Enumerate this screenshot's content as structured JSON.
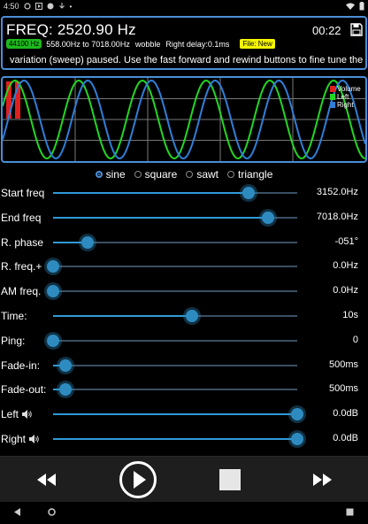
{
  "status_bar": {
    "time": "4:50"
  },
  "info": {
    "freq_title": "FREQ: 2520.90 Hz",
    "timer": "00:22",
    "sample_rate": "44100 Hz",
    "range": "558.00Hz to 7018.00Hz",
    "mode": "wobble",
    "delay": "Right delay:0.1ms",
    "file": "File: New",
    "message": "variation (sweep) paused. Use the fast forward and rewind buttons to fine tune the val"
  },
  "legend": [
    {
      "label": "Volume",
      "color": "#e02020"
    },
    {
      "label": "Left",
      "color": "#22d822"
    },
    {
      "label": "Right",
      "color": "#2f7fd8"
    }
  ],
  "waveforms": {
    "options": [
      "sine",
      "square",
      "sawt",
      "triangle"
    ],
    "selected": "sine"
  },
  "sliders": [
    {
      "label": "Start freq",
      "value": "3152.0Hz",
      "level": 0.8
    },
    {
      "label": "End freq",
      "value": "7018.0Hz",
      "level": 0.88
    },
    {
      "label": "R. phase",
      "value": "-051°",
      "level": 0.14
    },
    {
      "label": "R. freq.+",
      "value": "0.0Hz",
      "level": 0.0
    },
    {
      "label": "AM freq.",
      "value": "0.0Hz",
      "level": 0.0
    },
    {
      "label": "Time:",
      "value": "10s",
      "level": 0.57
    },
    {
      "label": "Ping:",
      "value": "0",
      "level": 0.0
    },
    {
      "label": "Fade-in:",
      "value": "500ms",
      "level": 0.05
    },
    {
      "label": "Fade-out:",
      "value": "500ms",
      "level": 0.05
    },
    {
      "label": "Left",
      "value": "0.0dB",
      "level": 1.0,
      "icon": "speaker-icon"
    },
    {
      "label": "Right",
      "value": "0.0dB",
      "level": 1.0,
      "icon": "speaker-icon"
    }
  ],
  "transport": {
    "buttons": [
      "rewind-icon",
      "play-icon",
      "stop-icon",
      "fast-forward-icon"
    ]
  },
  "navigation": [
    "back-icon",
    "home-icon",
    "recents-icon"
  ],
  "colors": {
    "accent": "#4a8ed8",
    "left_wave": "#22d822",
    "right_wave": "#2f7fd8",
    "volume": "#e02020",
    "rate_badge": "#1db81d",
    "file_badge": "#f4f400"
  }
}
